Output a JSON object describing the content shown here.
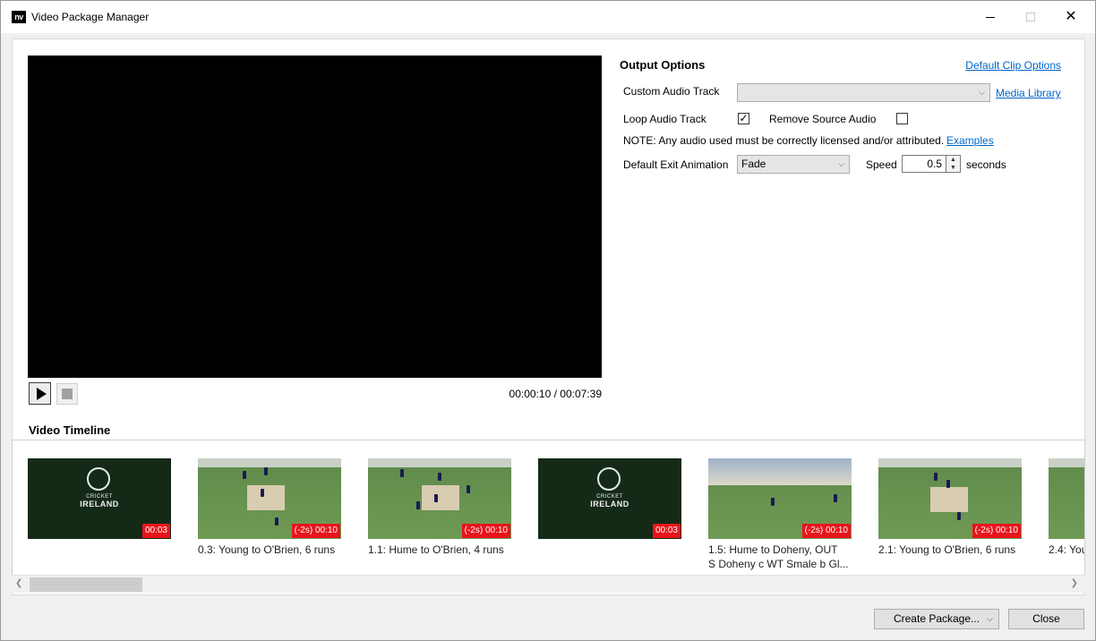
{
  "window": {
    "app_icon_text": "nv",
    "title": "Video Package Manager",
    "close_glyph": "✕"
  },
  "player": {
    "current_time": "00:00:10",
    "total_time": "00:07:39",
    "separator": " / "
  },
  "output_options": {
    "title": "Output Options",
    "default_clip_options_link": "Default Clip Options",
    "custom_audio_track_label": "Custom Audio Track",
    "custom_audio_track_value": "",
    "media_library_link": "Media Library",
    "loop_audio_track_label": "Loop Audio Track",
    "loop_audio_track_checked": true,
    "remove_source_audio_label": "Remove Source Audio",
    "remove_source_audio_checked": false,
    "note_text": "NOTE: Any audio used must be correctly licensed and/or attributed.",
    "examples_link": "Examples",
    "default_exit_animation_label": "Default Exit Animation",
    "default_exit_animation_value": "Fade",
    "speed_label": "Speed",
    "speed_value": "0.5",
    "seconds_label": "seconds"
  },
  "timeline": {
    "title": "Video Timeline",
    "clips": [
      {
        "type": "logo",
        "logo_top": "CRICKET",
        "logo_bottom": "IRELAND",
        "badge": "00:03",
        "label": ""
      },
      {
        "type": "field",
        "badge": "(-2s) 00:10",
        "label": "0.3: Young to O'Brien, 6 runs"
      },
      {
        "type": "field",
        "badge": "(-2s) 00:10",
        "label": "1.1: Hume to O'Brien, 4 runs"
      },
      {
        "type": "logo",
        "logo_top": "CRICKET",
        "logo_bottom": "IRELAND",
        "badge": "00:03",
        "label": ""
      },
      {
        "type": "field",
        "badge": "(-2s) 00:10",
        "label": "1.5: Hume to Doheny, OUT",
        "label2": "S Doheny c WT Smale b Gl..."
      },
      {
        "type": "field",
        "badge": "(-2s) 00:10",
        "label": "2.1: Young to O'Brien, 6 runs"
      },
      {
        "type": "field",
        "badge": "",
        "label": "2.4: You"
      }
    ]
  },
  "buttons": {
    "create_package": "Create Package...",
    "close": "Close"
  },
  "icons": {
    "dropdown_arrow": "chevron-down-icon",
    "check": "checkmark-icon"
  }
}
